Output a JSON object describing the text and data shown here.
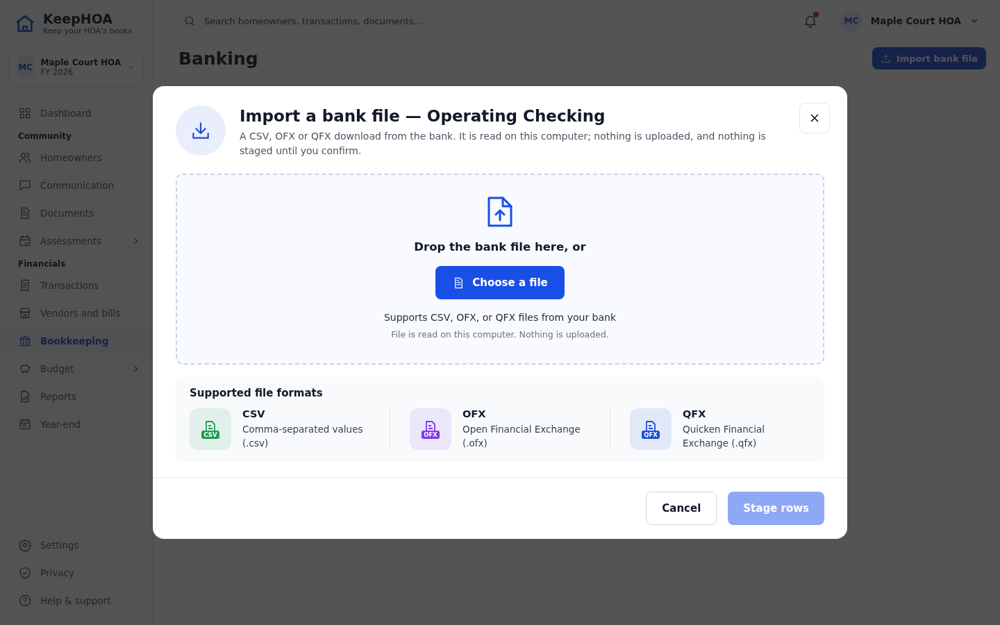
{
  "brand": {
    "name": "KeepHOA",
    "tagline": "Keep your HOA's books"
  },
  "org_switcher": {
    "initials": "MC",
    "name": "Maple Court HOA",
    "period": "FY 2026"
  },
  "sidebar": {
    "sections": [
      {
        "items": [
          {
            "label": "Dashboard",
            "selected": false,
            "has_submenu": false
          }
        ]
      },
      {
        "title": "Community",
        "items": [
          {
            "label": "Homeowners",
            "selected": false,
            "has_submenu": false
          },
          {
            "label": "Communication",
            "selected": false,
            "has_submenu": false
          },
          {
            "label": "Documents",
            "selected": false,
            "has_submenu": false
          },
          {
            "label": "Assessments",
            "selected": false,
            "has_submenu": true
          }
        ]
      },
      {
        "title": "Financials",
        "items": [
          {
            "label": "Transactions",
            "selected": false,
            "has_submenu": false
          },
          {
            "label": "Vendors and bills",
            "selected": false,
            "has_submenu": false
          },
          {
            "label": "Bookkeeping",
            "selected": true,
            "has_submenu": false
          },
          {
            "label": "Budget",
            "selected": false,
            "has_submenu": true
          },
          {
            "label": "Reports",
            "selected": false,
            "has_submenu": false
          },
          {
            "label": "Year-end",
            "selected": false,
            "has_submenu": false
          }
        ]
      }
    ],
    "footer": [
      {
        "label": "Settings"
      },
      {
        "label": "Privacy"
      },
      {
        "label": "Help & support"
      }
    ]
  },
  "topbar": {
    "search": {
      "placeholder": "Search homeowners, transactions, documents..."
    },
    "notifications_unread": true,
    "account": {
      "initials": "MC",
      "name": "Maple Court HOA"
    }
  },
  "page": {
    "title": "Banking",
    "action": "Import bank file"
  },
  "dialog": {
    "title": "Import a bank file — Operating Checking",
    "description": "A CSV, OFX or QFX download from the bank. It is read on this computer; nothing is uploaded, and nothing is staged until you confirm.",
    "dropzone": {
      "prompt": "Drop the bank file here, or",
      "button": "Choose a file",
      "supports": "Supports CSV, OFX, or QFX files from your bank",
      "note": "File is read on this computer. Nothing is uploaded."
    },
    "formats_title": "Supported file formats",
    "formats": [
      {
        "badge": "CSV",
        "name": "CSV",
        "description": "Comma-separated values (.csv)",
        "color": "#1f9d55"
      },
      {
        "badge": "OFX",
        "name": "OFX",
        "description": "Open Financial Exchange (.ofx)",
        "color": "#7c3aed"
      },
      {
        "badge": "QFX",
        "name": "QFX",
        "description": "Quicken Financial Exchange (.qfx)",
        "color": "#1d4ed8"
      }
    ],
    "buttons": [
      {
        "label": "Cancel",
        "kind": "secondary",
        "disabled": false
      },
      {
        "label": "Stage rows",
        "kind": "primary",
        "disabled": true
      }
    ]
  }
}
